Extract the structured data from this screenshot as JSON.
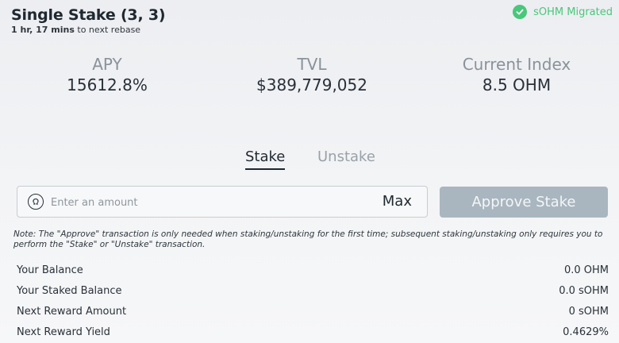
{
  "header": {
    "title": "Single Stake (3, 3)",
    "rebase_time": "1 hr, 17 mins",
    "rebase_suffix": " to next rebase"
  },
  "migration": {
    "status_text": "sOHM Migrated",
    "icon": "check-circle-icon",
    "color": "#49c77a"
  },
  "metrics": [
    {
      "label": "APY",
      "value": "15612.8%"
    },
    {
      "label": "TVL",
      "value": "$389,779,052"
    },
    {
      "label": "Current Index",
      "value": "8.5 OHM"
    }
  ],
  "tabs": {
    "stake": "Stake",
    "unstake": "Unstake",
    "active": "stake"
  },
  "amount": {
    "placeholder": "Enter an amount",
    "value": "",
    "icon": "ohm-token-icon",
    "max_label": "Max"
  },
  "approve_button": {
    "label": "Approve Stake",
    "color": "#a9b6bf"
  },
  "note": "Note: The \"Approve\" transaction is only needed when staking/unstaking for the first time; subsequent staking/unstaking only requires you to perform the \"Stake\" or \"Unstake\" transaction.",
  "stats": [
    {
      "label": "Your Balance",
      "value": "0.0 OHM"
    },
    {
      "label": "Your Staked Balance",
      "value": "0.0 sOHM"
    },
    {
      "label": "Next Reward Amount",
      "value": "0 sOHM"
    },
    {
      "label": "Next Reward Yield",
      "value": "0.4629%"
    }
  ]
}
